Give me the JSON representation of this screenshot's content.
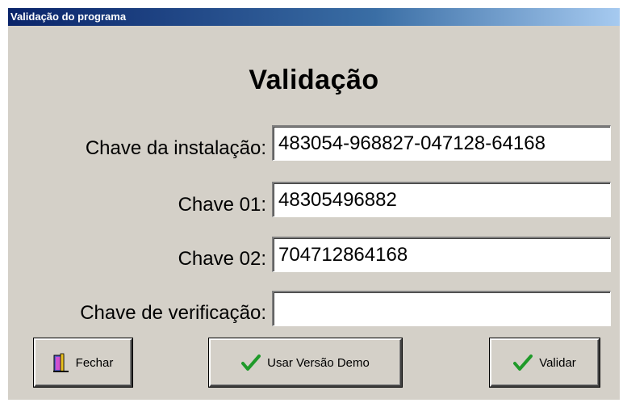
{
  "window": {
    "title": "Validação do programa"
  },
  "heading": "Validação",
  "fields": {
    "installation_key": {
      "label": "Chave da instalação:",
      "value": "483054-968827-047128-64168"
    },
    "key01": {
      "label": "Chave 01:",
      "value": "48305496882"
    },
    "key02": {
      "label": "Chave 02:",
      "value": "704712864168"
    },
    "verification_key": {
      "label": "Chave de verificação:",
      "value": ""
    }
  },
  "buttons": {
    "close": {
      "label": "Fechar",
      "icon": "door-exit-icon"
    },
    "demo": {
      "label": "Usar Versão Demo",
      "icon": "checkmark-icon"
    },
    "validate": {
      "label": "Validar",
      "icon": "checkmark-icon"
    }
  },
  "colors": {
    "titlebar_start": "#0a246a",
    "titlebar_end": "#a6caf0",
    "face": "#d4d0c8",
    "check": "#1f9a2a"
  }
}
